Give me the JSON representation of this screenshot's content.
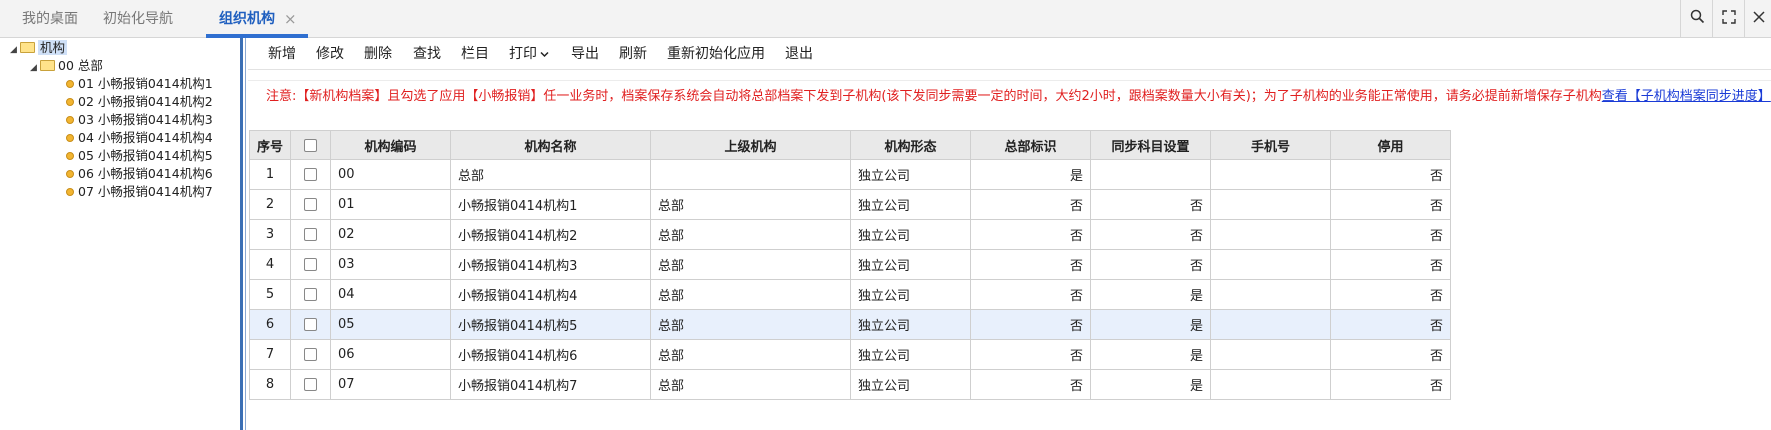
{
  "tabs": {
    "desktop": "我的桌面",
    "init_nav": "初始化导航",
    "org": "组织机构",
    "close": "×"
  },
  "window": {
    "search_icon": "search-icon",
    "fullscreen_icon": "fullscreen-icon",
    "close_icon": "close-icon"
  },
  "tree": {
    "root": "机构",
    "hq": "00 总部",
    "children": [
      "01 小畅报销0414机构1",
      "02 小畅报销0414机构2",
      "03 小畅报销0414机构3",
      "04 小畅报销0414机构4",
      "05 小畅报销0414机构5",
      "06 小畅报销0414机构6",
      "07 小畅报销0414机构7"
    ]
  },
  "toolbar": {
    "add": "新增",
    "edit": "修改",
    "delete": "删除",
    "find": "查找",
    "columns": "栏目",
    "print": "打印",
    "export": "导出",
    "refresh": "刷新",
    "reinit": "重新初始化应用",
    "exit": "退出"
  },
  "notice": {
    "text": "注意:【新机构档案】且勾选了应用【小畅报销】任一业务时，档案保存系统会自动将总部档案下发到子机构(该下发同步需要一定的时间，大约2小时，跟档案数量大小有关)；为了子机构的业务能正常使用，请务必提前新增保存子机构",
    "link": "查看【子机构档案同步进度】"
  },
  "table": {
    "headers": [
      "序号",
      "",
      "机构编码",
      "机构名称",
      "上级机构",
      "机构形态",
      "总部标识",
      "同步科目设置",
      "手机号",
      "停用"
    ],
    "rows": [
      [
        "1",
        "00",
        "总部",
        "",
        "独立公司",
        "是",
        "",
        "",
        "否"
      ],
      [
        "2",
        "01",
        "小畅报销0414机构1",
        "总部",
        "独立公司",
        "否",
        "否",
        "",
        "否"
      ],
      [
        "3",
        "02",
        "小畅报销0414机构2",
        "总部",
        "独立公司",
        "否",
        "否",
        "",
        "否"
      ],
      [
        "4",
        "03",
        "小畅报销0414机构3",
        "总部",
        "独立公司",
        "否",
        "否",
        "",
        "否"
      ],
      [
        "5",
        "04",
        "小畅报销0414机构4",
        "总部",
        "独立公司",
        "否",
        "是",
        "",
        "否"
      ],
      [
        "6",
        "05",
        "小畅报销0414机构5",
        "总部",
        "独立公司",
        "否",
        "是",
        "",
        "否"
      ],
      [
        "7",
        "06",
        "小畅报销0414机构6",
        "总部",
        "独立公司",
        "否",
        "是",
        "",
        "否"
      ],
      [
        "8",
        "07",
        "小畅报销0414机构7",
        "总部",
        "独立公司",
        "否",
        "是",
        "",
        "否"
      ]
    ]
  }
}
